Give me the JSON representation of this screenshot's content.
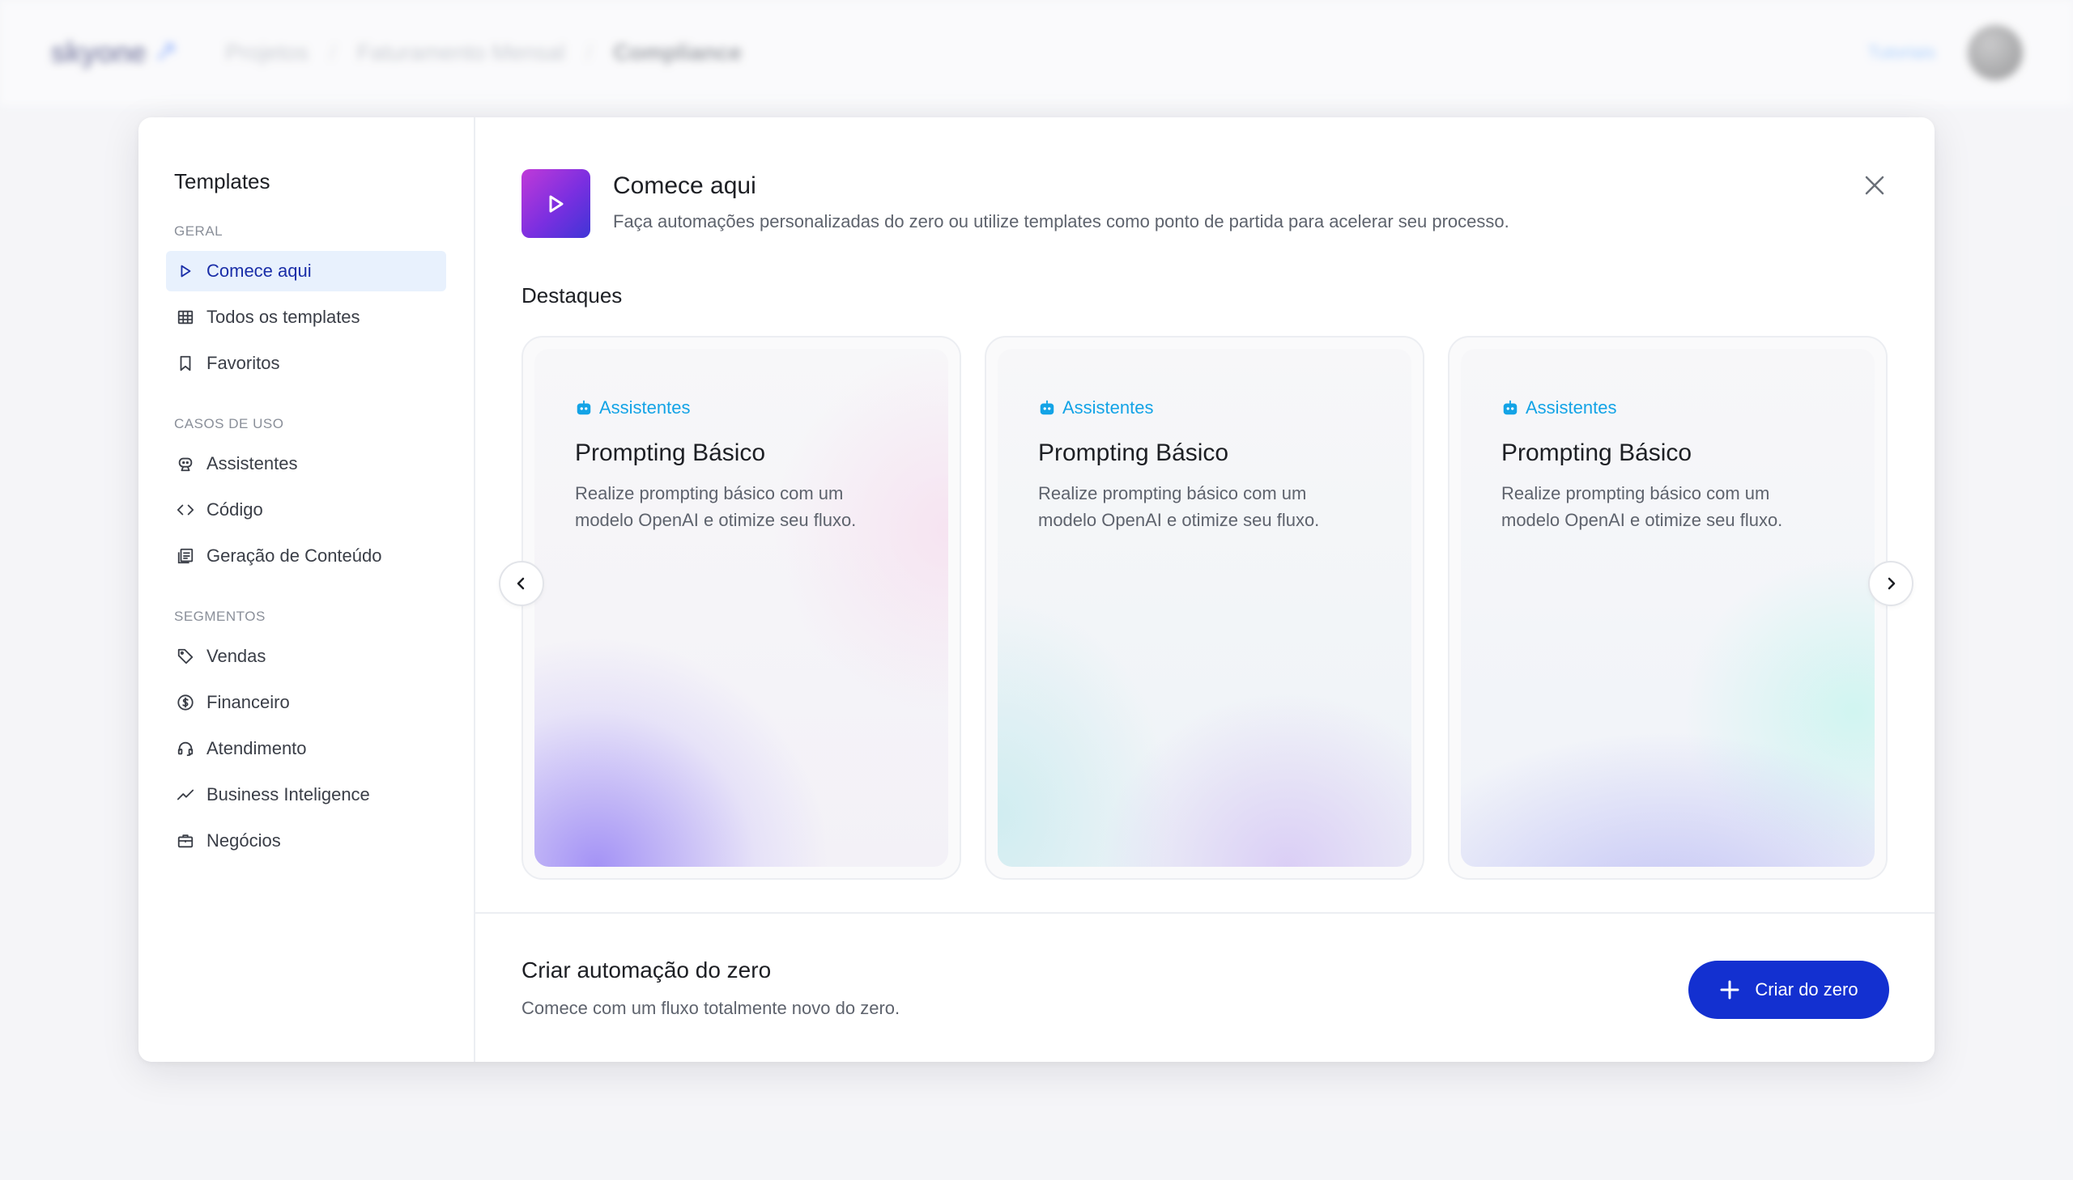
{
  "app_header": {
    "logo": "skyone",
    "logo_accent": "↗",
    "breadcrumbs": [
      "Projetos",
      "Faturamento Mensal",
      "Compliance"
    ],
    "right_link": "Tutoriais",
    "avatar_icon": "user-avatar"
  },
  "sidebar": {
    "title": "Templates",
    "sections": [
      {
        "label": "GERAL",
        "items": [
          {
            "label": "Comece aqui",
            "icon": "play-icon",
            "active": true
          },
          {
            "label": "Todos os templates",
            "icon": "grid-icon"
          },
          {
            "label": "Favoritos",
            "icon": "bookmark-icon"
          }
        ]
      },
      {
        "label": "CASOS DE USO",
        "items": [
          {
            "label": "Assistentes",
            "icon": "robot-icon"
          },
          {
            "label": "Código",
            "icon": "code-icon"
          },
          {
            "label": "Geração de Conteúdo",
            "icon": "document-icon"
          }
        ]
      },
      {
        "label": "SEGMENTOS",
        "items": [
          {
            "label": "Vendas",
            "icon": "tag-icon"
          },
          {
            "label": "Financeiro",
            "icon": "dollar-icon"
          },
          {
            "label": "Atendimento",
            "icon": "headset-icon"
          },
          {
            "label": "Business Inteligence",
            "icon": "trend-icon"
          },
          {
            "label": "Negócios",
            "icon": "briefcase-icon"
          }
        ]
      }
    ]
  },
  "main": {
    "title": "Comece aqui",
    "subtitle": "Faça automações personalizadas do zero ou utilize templates como ponto de partida para acelerar seu processo.",
    "highlights_title": "Destaques",
    "cards": [
      {
        "badge": "Assistentes",
        "title": "Prompting Básico",
        "description": "Realize prompting básico com um modelo OpenAI e otimize seu fluxo."
      },
      {
        "badge": "Assistentes",
        "title": "Prompting Básico",
        "description": "Realize prompting básico com um modelo OpenAI e otimize seu fluxo."
      },
      {
        "badge": "Assistentes",
        "title": "Prompting Básico",
        "description": "Realize prompting básico com um modelo OpenAI e otimize seu fluxo."
      }
    ]
  },
  "bottom": {
    "title": "Criar automação do zero",
    "subtitle": "Comece com um fluxo totalmente novo do zero.",
    "button_label": "Criar do zero"
  },
  "colors": {
    "accent": "#1330d0",
    "active_bg": "#e8f1fd",
    "badge": "#13a3e6"
  }
}
